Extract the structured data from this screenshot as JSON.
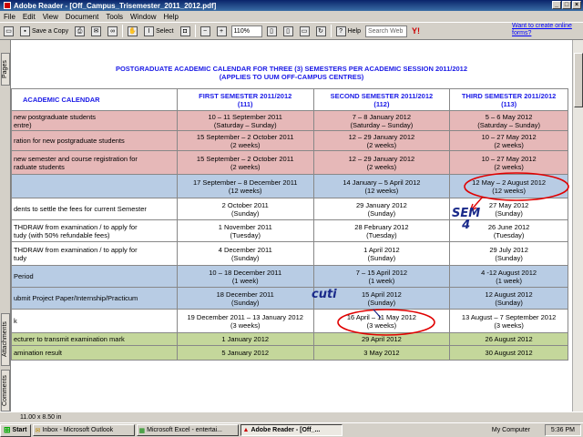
{
  "window": {
    "title": "Adobe Reader - [Off_Campus_Trisemester_2011_2012.pdf]",
    "buttons": [
      "_",
      "□",
      "×"
    ]
  },
  "menu": [
    "File",
    "Edit",
    "View",
    "Document",
    "Tools",
    "Window",
    "Help"
  ],
  "toolbar": {
    "save_copy": "Save a Copy",
    "select": "Select",
    "zoom": "110%",
    "help": "Help",
    "search_placeholder": "Search Web",
    "online_link": "Want to create online forms?"
  },
  "side_tabs": [
    "Pages",
    "Attachments",
    "Comments"
  ],
  "document": {
    "heading1": "POSTGRADUATE ACADEMIC CALENDAR FOR THREE (3) SEMESTERS PER ACADEMIC SESSION 2011/2012",
    "heading2": "(APPLIES TO UUM OFF-CAMPUS CENTRES)",
    "headers": {
      "c0": "ACADEMIC CALENDAR",
      "c1a": "FIRST SEMESTER 2011/2012",
      "c1b": "(111)",
      "c2a": "SECOND SEMESTER 2011/2012",
      "c2b": "(112)",
      "c3a": "THIRD SEMESTER 2011/2012",
      "c3b": "(113)"
    },
    "rows": [
      {
        "label": "new postgraduate students\nentre)",
        "c1": "10 – 11 September 2011",
        "c1b": "(Saturday – Sunday)",
        "c2": "7 – 8 January 2012",
        "c2b": "(Saturday – Sunday)",
        "c3": "5 – 6 May 2012",
        "c3b": "(Saturday – Sunday)"
      },
      {
        "label": "ration for new postgraduate students",
        "c1": "15 September – 2 October 2011",
        "c1b": "(2 weeks)",
        "c2": "12 – 29 January 2012",
        "c2b": "(2 weeks)",
        "c3": "10 – 27 May 2012",
        "c3b": "(2 weeks)"
      },
      {
        "label": "new semester and course registration for\nraduate students",
        "c1": "15 September – 2 October 2011",
        "c1b": "(2 weeks)",
        "c2": "12 – 29 January 2012",
        "c2b": "(2 weeks)",
        "c3": "10 – 27 May 2012",
        "c3b": "(2 weeks)"
      },
      {
        "label": "",
        "c1": "17 September – 8 December 2011",
        "c1b": "(12 weeks)",
        "c2": "14 January – 5 April 2012",
        "c2b": "(12 weeks)",
        "c3": "12 May – 2 August 2012",
        "c3b": "(12 weeks)"
      },
      {
        "label": "dents to settle the fees for current Semester",
        "c1": "2 October 2011",
        "c1b": "(Sunday)",
        "c2": "29 January 2012",
        "c2b": "(Sunday)",
        "c3": "27 May 2012",
        "c3b": "(Sunday)"
      },
      {
        "label": "THDRAW from examination / to apply for\ntudy (with 50% refundable fees)",
        "c1": "1 November 2011",
        "c1b": "(Tuesday)",
        "c2": "28 February 2012",
        "c2b": "(Tuesday)",
        "c3": "26 June 2012",
        "c3b": "(Tuesday)"
      },
      {
        "label": "THDRAW from examination / to apply for\ntudy",
        "c1": "4 December 2011",
        "c1b": "(Sunday)",
        "c2": "1 April 2012",
        "c2b": "(Sunday)",
        "c3": "29 July 2012",
        "c3b": "(Sunday)"
      },
      {
        "label": "Period",
        "c1": "10 – 18 December 2011",
        "c1b": "(1 week)",
        "c2": "7 – 15 April 2012",
        "c2b": "(1 week)",
        "c3": "4 -12 August 2012",
        "c3b": "(1 week)"
      },
      {
        "label": "ubmit Project Paper/Internship/Practicum",
        "c1": "18 December 2011",
        "c1b": "(Sunday)",
        "c2": "15 April 2012",
        "c2b": "(Sunday)",
        "c3": "12 August 2012",
        "c3b": "(Sunday)"
      },
      {
        "label": "k",
        "c1": "19 December 2011 – 13 January 2012",
        "c1b": "(3 weeks)",
        "c2": "16 April – 11 May 2012",
        "c2b": "(3 weeks)",
        "c3": "13 August – 7 September 2012",
        "c3b": "(3 weeks)"
      },
      {
        "label": "ecturer to transmit examination mark",
        "c1": "1 January 2012",
        "c1b": "",
        "c2": "29 April 2012",
        "c2b": "",
        "c3": "26 August 2012",
        "c3b": ""
      },
      {
        "label": "amination result",
        "c1": "5 January 2012",
        "c1b": "",
        "c2": "3 May 2012",
        "c2b": "",
        "c3": "30 August 2012",
        "c3b": ""
      }
    ],
    "row_colors": [
      "pink",
      "pink",
      "pink",
      "blue",
      "white",
      "white",
      "white",
      "blue",
      "blue",
      "white",
      "green",
      "green"
    ]
  },
  "annotations": {
    "sem4": "SEM\n4",
    "cuti": "cuti"
  },
  "status": {
    "page_size": "11.00 x 8.50 in"
  },
  "taskbar": {
    "start": "Start",
    "tasks": [
      "Inbox - Microsoft Outlook",
      "Microsoft Excel - entertai...",
      "Adobe Reader - [Off_..."
    ],
    "my_computer": "My Computer",
    "clock": "5:36 PM"
  },
  "colors": {
    "heading": "#1a1ae6",
    "pink": "#e6b8b8",
    "blue": "#b8cce4",
    "green": "#c4d79b",
    "annotation_red": "#e00000",
    "annotation_blue": "#1a2a8a"
  }
}
